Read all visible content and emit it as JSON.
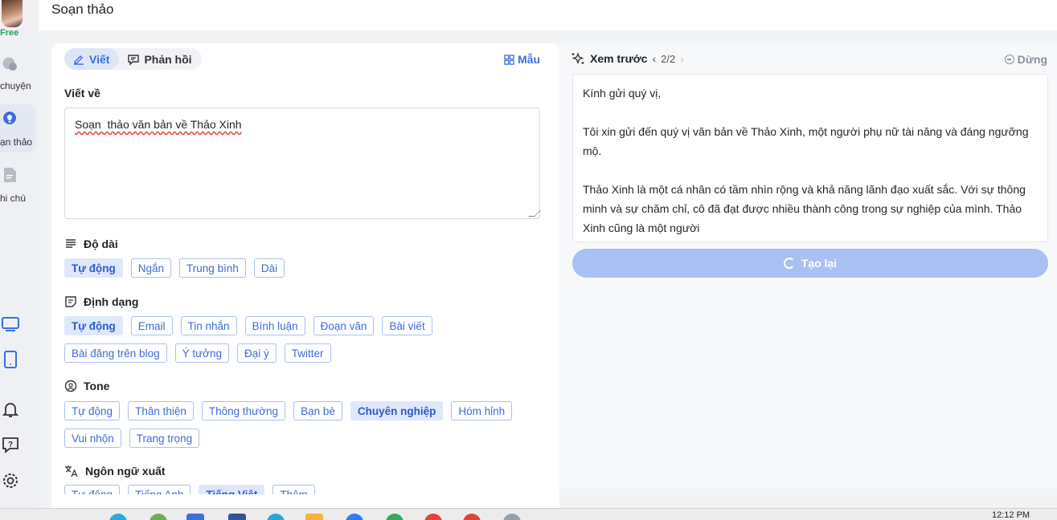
{
  "sidebar": {
    "plan_badge": "Free",
    "items": [
      {
        "label": "chuyện",
        "icon": "chat-icon"
      },
      {
        "label": "ạn thảo",
        "icon": "lightbulb-icon"
      },
      {
        "label": "hi chú",
        "icon": "note-icon"
      }
    ],
    "bottom_icons": [
      "desktop-icon",
      "tablet-icon",
      "bell-icon",
      "help-icon",
      "settings-icon"
    ]
  },
  "header": {
    "title": "Soạn thảo"
  },
  "compose": {
    "tabs": [
      {
        "label": "Viết",
        "active": true
      },
      {
        "label": "Phản hồi",
        "active": false
      }
    ],
    "template_label": "Mẫu",
    "write_about_label": "Viết về",
    "write_about_value": "Soạn  thảo văn bản về Thảo Xinh",
    "length": {
      "label": "Độ dài",
      "options": [
        {
          "label": "Tự động",
          "selected": true
        },
        {
          "label": "Ngắn",
          "selected": false
        },
        {
          "label": "Trung bình",
          "selected": false
        },
        {
          "label": "Dài",
          "selected": false
        }
      ]
    },
    "format": {
      "label": "Định dạng",
      "options_row1": [
        {
          "label": "Tự động",
          "selected": true
        },
        {
          "label": "Email",
          "selected": false
        },
        {
          "label": "Tin nhắn",
          "selected": false
        },
        {
          "label": "Bình luận",
          "selected": false
        },
        {
          "label": "Đoạn văn",
          "selected": false
        },
        {
          "label": "Bài viết",
          "selected": false
        }
      ],
      "options_row2": [
        {
          "label": "Bài đăng trên blog",
          "selected": false
        },
        {
          "label": "Ý tưởng",
          "selected": false
        },
        {
          "label": "Đại ý",
          "selected": false
        },
        {
          "label": "Twitter",
          "selected": false
        }
      ]
    },
    "tone": {
      "label": "Tone",
      "options_row1": [
        {
          "label": "Tự động",
          "selected": false
        },
        {
          "label": "Thân thiện",
          "selected": false
        },
        {
          "label": "Thông thường",
          "selected": false
        },
        {
          "label": "Bạn bè",
          "selected": false
        },
        {
          "label": "Chuyên nghiệp",
          "selected": true
        },
        {
          "label": "Hóm hỉnh",
          "selected": false
        }
      ],
      "options_row2": [
        {
          "label": "Vui nhộn",
          "selected": false
        },
        {
          "label": "Trang trọng",
          "selected": false
        }
      ]
    },
    "output_language": {
      "label": "Ngôn ngữ xuất",
      "options": [
        {
          "label": "Tự động",
          "selected": false
        },
        {
          "label": "Tiếng Anh",
          "selected": false
        },
        {
          "label": "Tiếng Việt",
          "selected": true
        },
        {
          "label": "Thêm",
          "selected": false
        }
      ]
    }
  },
  "preview": {
    "label": "Xem trước",
    "page": "2/2",
    "stop_label": "Dừng",
    "paragraphs": [
      "Kính gửi quý vị,",
      "Tôi xin gửi đến quý vị văn bản về Thảo Xinh, một người phụ nữ tài năng và đáng ngưỡng mộ.",
      "Thảo Xinh là một cá nhân có tầm nhìn rộng và khả năng lãnh đạo xuất sắc. Với sự thông minh và sự chăm chỉ, cô đã đạt được nhiều thành công trong sự nghiệp của mình. Thảo Xinh cũng là một người"
    ],
    "regenerate_label": "Tạo lại"
  },
  "taskbar": {
    "time": "12:12 PM"
  },
  "colors": {
    "accent": "#3c6ee0",
    "chip_border": "#aac0ee",
    "selected_chip_bg": "#dfe8fb",
    "regen_button": "#a9c0f3",
    "free_badge": "#25a35a"
  }
}
